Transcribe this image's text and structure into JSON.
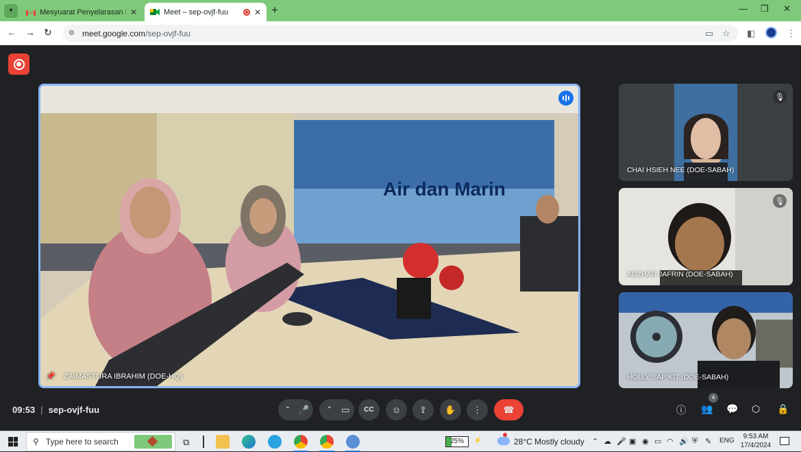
{
  "browser": {
    "tabs": [
      {
        "title": "Mesyuarat Penyelarasan Permo",
        "favicon": "gmail-icon"
      },
      {
        "title": "Meet – sep-ovjf-fuu",
        "favicon": "meet-icon",
        "recording": true
      }
    ],
    "new_tab": "+",
    "url_host": "meet.google.com",
    "url_path": "/sep-ovjf-fuu"
  },
  "meet": {
    "main_participant": "ZAIMASTURA IBRAHIM (DOE-HQ)",
    "participants": [
      {
        "name": "CHAI HSIEH NEE (DOE-SABAH)",
        "muted": true
      },
      {
        "name": "ADZHAR JAFRIN (DOE-SABAH)",
        "muted": true
      },
      {
        "name": "HOLLY SAPIKIT (DOE-SABAH)",
        "muted": false
      }
    ],
    "time": "09:53",
    "meeting_code": "sep-ovjf-fuu",
    "people_count": "4",
    "controls": {
      "captions": "CC"
    }
  },
  "taskbar": {
    "search_placeholder": "Type here to search",
    "battery": "25%",
    "temperature": "28°C",
    "weather": "Mostly cloudy",
    "language": "ENG",
    "time": "9:53 AM",
    "date": "17/4/2024"
  },
  "colors": {
    "tab_strip": "#7ec97a",
    "meet_background": "#202124",
    "active_speaker_border": "#8ab4f8",
    "hangup": "#ea4335"
  }
}
